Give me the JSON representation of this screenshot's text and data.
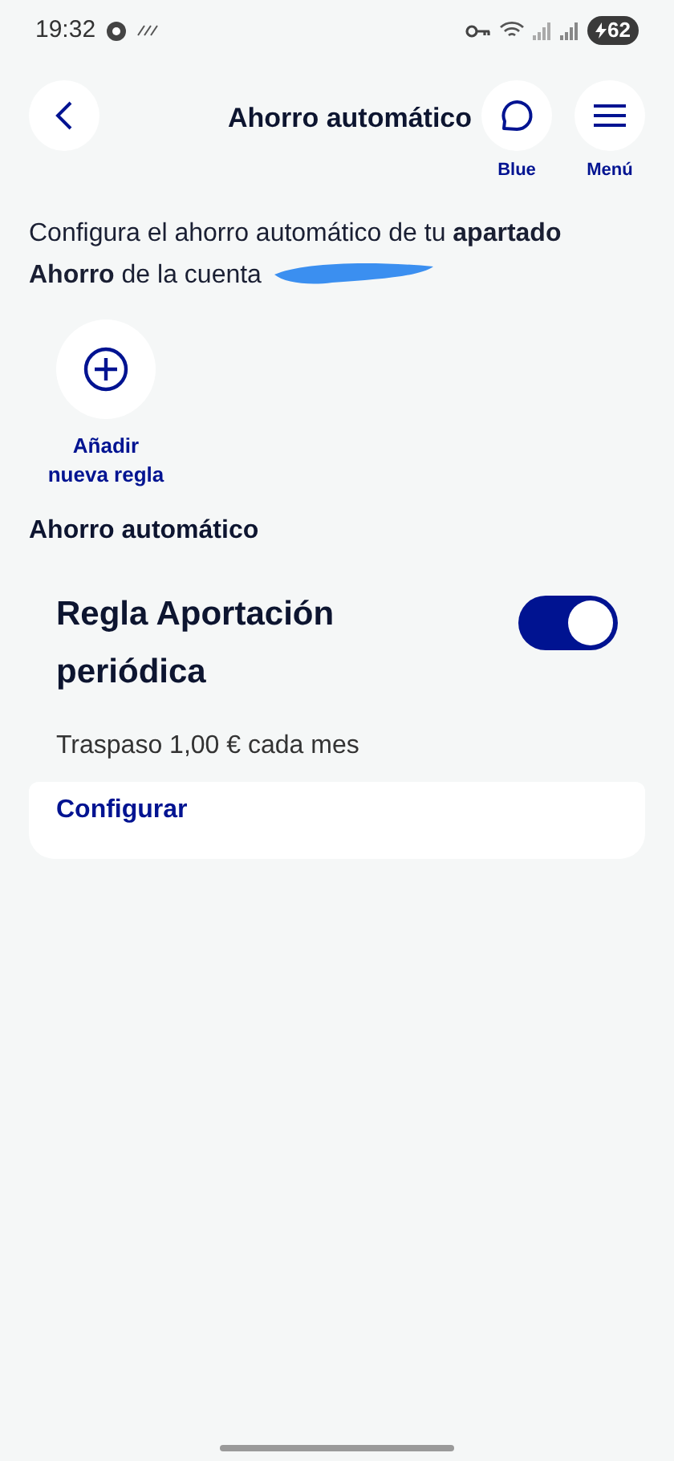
{
  "status_bar": {
    "time": "19:32",
    "battery": "62"
  },
  "header": {
    "title": "Ahorro automático",
    "actions": [
      {
        "kind": "chat",
        "label": "Blue"
      },
      {
        "kind": "menu",
        "label": "Menú"
      }
    ]
  },
  "intro": "Configura el ahorro automático de tu **apartado** **Ahorro** de la cuenta",
  "add_rule": {
    "label": "Añadir nueva regla"
  },
  "section_title": "Ahorro automático",
  "rules": [
    {
      "title": "Regla Aportación periódica",
      "on": true,
      "detail": "Traspaso 1,00 € cada mes",
      "action": "Configurar"
    }
  ]
}
